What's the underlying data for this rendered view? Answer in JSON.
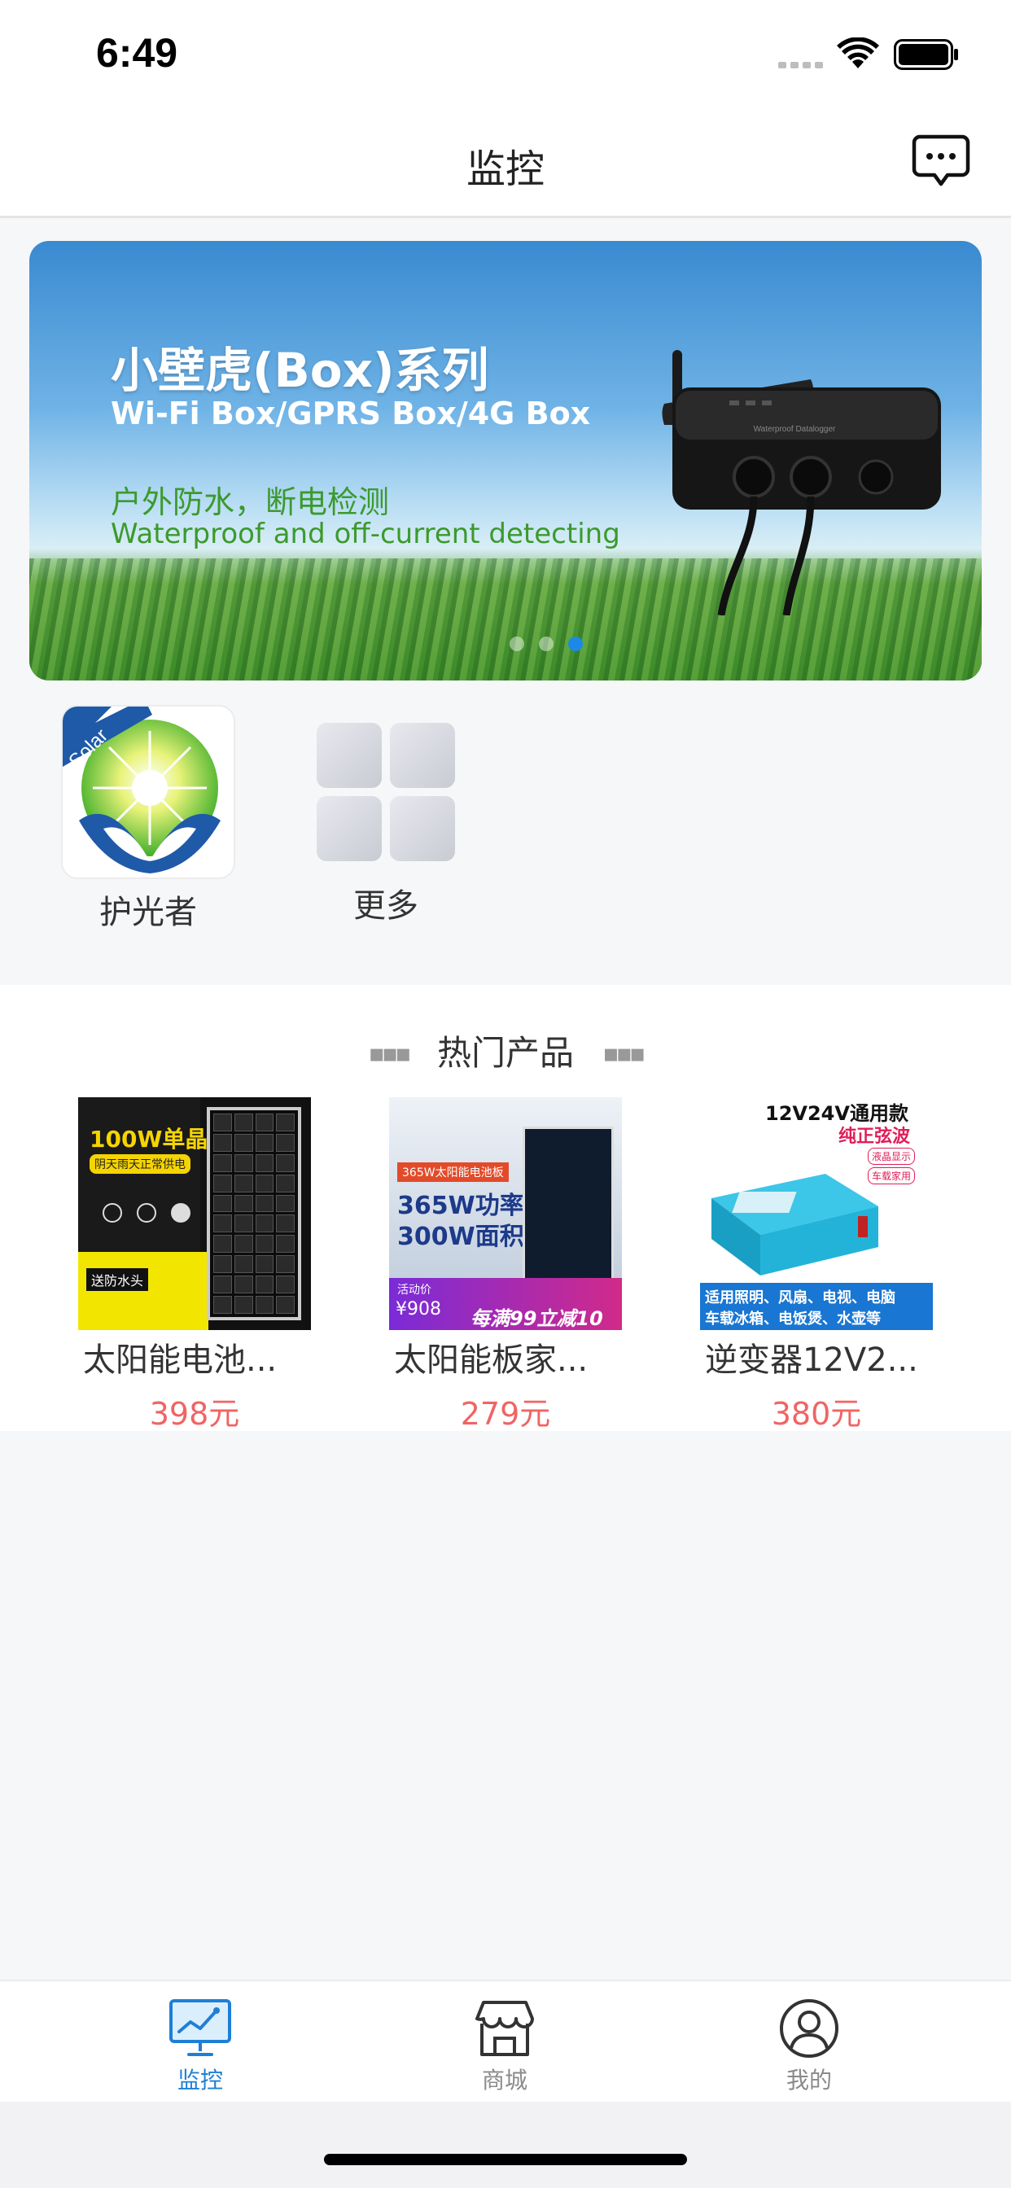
{
  "status_bar": {
    "time": "6:49"
  },
  "nav": {
    "title": "监控"
  },
  "banner": {
    "title": "小壁虎(Box)系列",
    "subtitle": "Wi-Fi Box/GPRS Box/4G Box",
    "tagline_cn": "户外防水，断电检测",
    "tagline_en": "Waterproof and off-current detecting",
    "device_label": "Waterproof Datalogger",
    "active_slide": 3,
    "slide_count": 3
  },
  "apps": [
    {
      "label": "护光者",
      "badge": "Solar"
    },
    {
      "label": "更多"
    }
  ],
  "hot_products": {
    "title": "热门产品",
    "items": [
      {
        "name": "太阳能电池...",
        "price": "398元",
        "image_text": [
          "100W单晶",
          "阴天雨天正常供电",
          "送防水头"
        ]
      },
      {
        "name": "太阳能板家...",
        "price": "279元",
        "image_text": [
          "365W太阳能电池板",
          "365W功率",
          "300W面积",
          "活动价",
          "¥908",
          "每满99立减10"
        ]
      },
      {
        "name": "逆变器12V2...",
        "price": "380元",
        "image_text": [
          "12V24V通用款",
          "纯正弦波",
          "液晶显示",
          "车载家用",
          "适用照明、风扇、电视、电脑",
          "车载冰箱、电饭煲、水壶等"
        ]
      }
    ]
  },
  "tabs": [
    {
      "label": "监控",
      "active": true
    },
    {
      "label": "商城",
      "active": false
    },
    {
      "label": "我的",
      "active": false
    }
  ],
  "colors": {
    "accent": "#1e7fd6",
    "price": "#f06464"
  }
}
